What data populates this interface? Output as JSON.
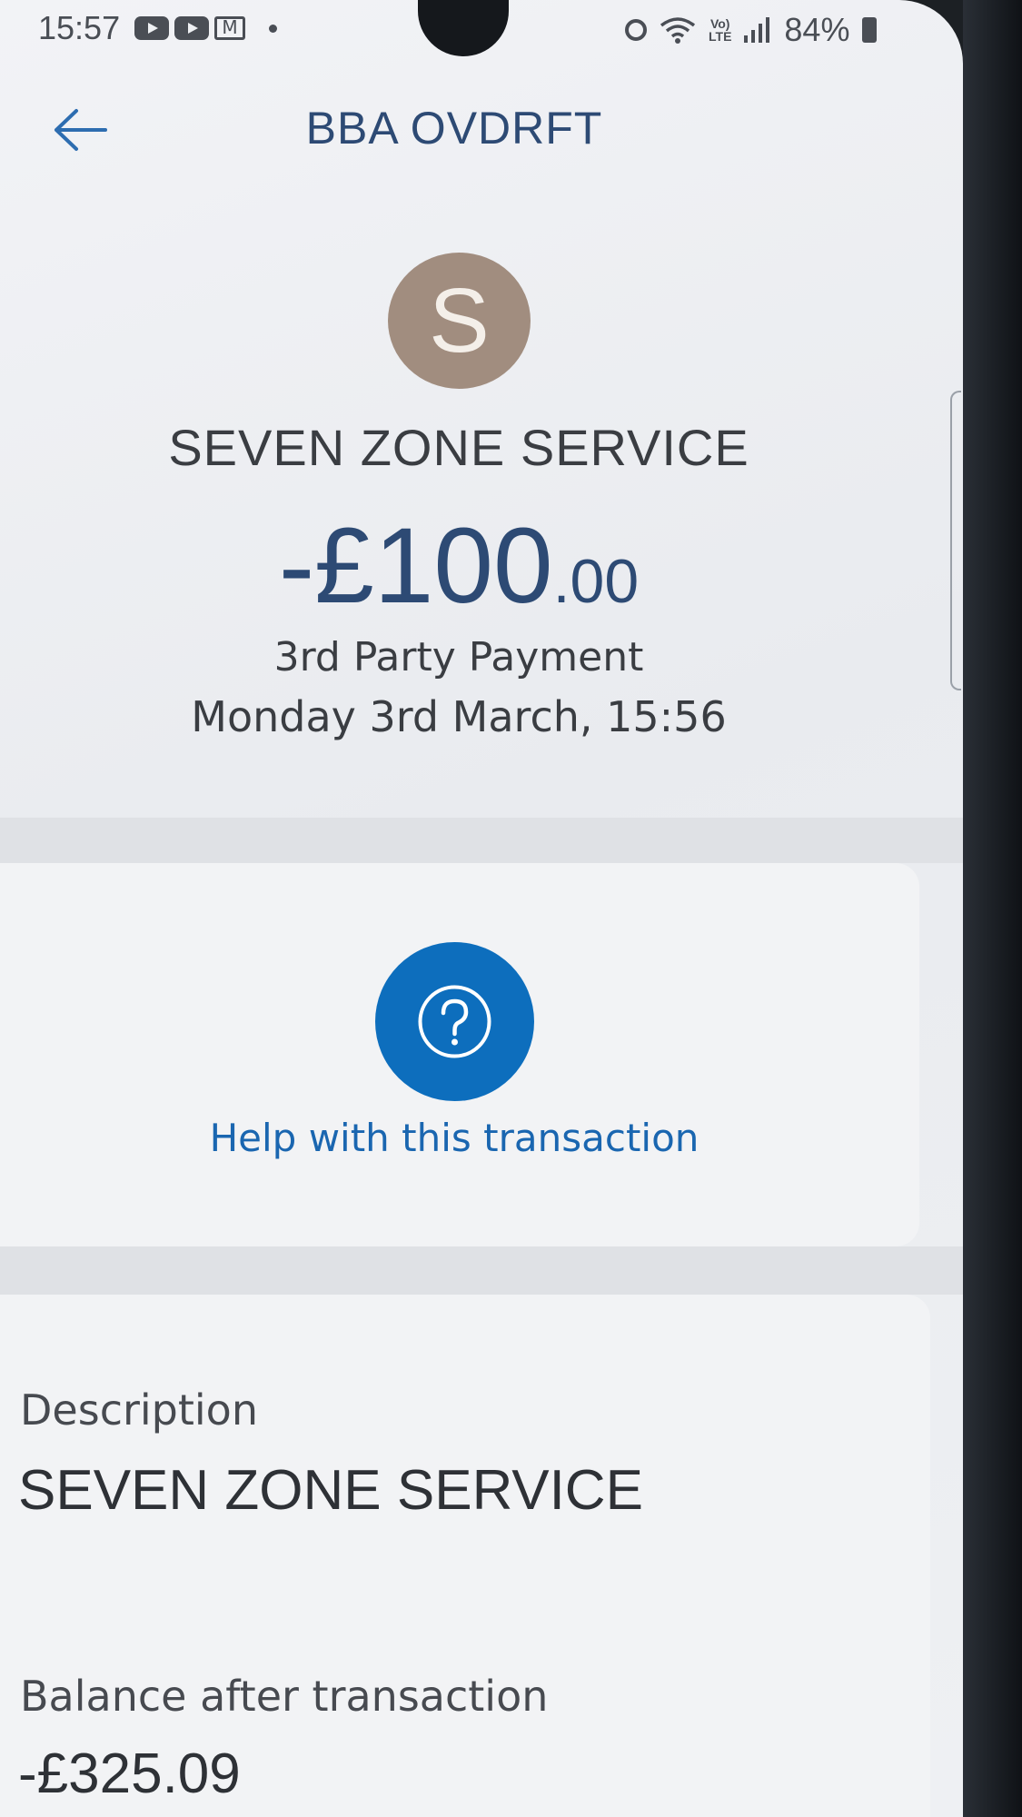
{
  "status_bar": {
    "time": "15:57",
    "mail_glyph": "M",
    "volte": "Vo)\nLTE",
    "battery": "84%",
    "icons": [
      "youtube-icon",
      "youtube-icon",
      "gmail-icon",
      "dot-icon",
      "alarm-icon",
      "wifi-icon",
      "volte-icon",
      "signal-icon",
      "battery-icon"
    ]
  },
  "header": {
    "title": "BBA OVDRFT",
    "back_icon": "arrow-left-icon"
  },
  "transaction": {
    "avatar_letter": "S",
    "merchant": "SEVEN ZONE SERVICE",
    "amount_main": "-£100",
    "amount_pence": ".00",
    "type": "3rd Party Payment",
    "datetime": "Monday 3rd March, 15:56"
  },
  "help": {
    "icon": "question-circle-icon",
    "label": "Help with this transaction"
  },
  "details": {
    "description_label": "Description",
    "description_value": "SEVEN ZONE SERVICE",
    "balance_label": "Balance after transaction",
    "balance_value": "-£325.09"
  },
  "colors": {
    "brand_blue": "#0d6ebd",
    "title_navy": "#2d4a74",
    "avatar_bg": "#a18d7f"
  }
}
